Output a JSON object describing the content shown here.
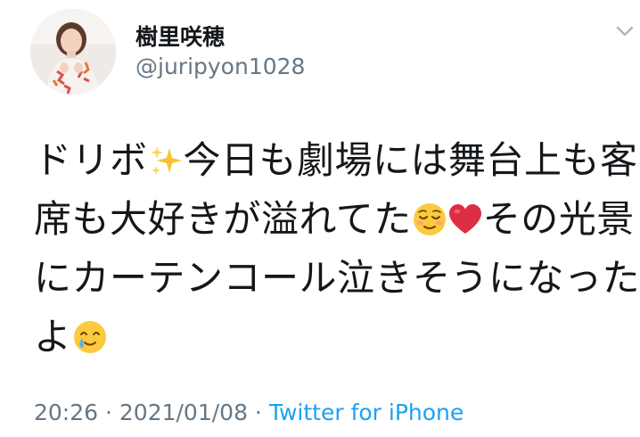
{
  "tweet": {
    "display_name": "樹里咲穂",
    "handle": "@juripyon1028",
    "text_lines": [
      [
        "ドリボ",
        "✨",
        "今日も劇場には舞台上も客"
      ],
      [
        "席も大好きが溢れてた",
        "😌",
        "❤️",
        "その光景"
      ],
      [
        "にカーテンコール泣きそうになった"
      ],
      [
        "よ",
        "🥲"
      ]
    ],
    "timestamp": "20:26 · 2021/01/08 · ",
    "source": "Twitter for iPhone"
  },
  "icons": {
    "more": "chevron-down-icon",
    "avatar": "profile-avatar"
  },
  "colors": {
    "text": "#14171a",
    "secondary": "#657786",
    "link": "#1da1f2"
  }
}
